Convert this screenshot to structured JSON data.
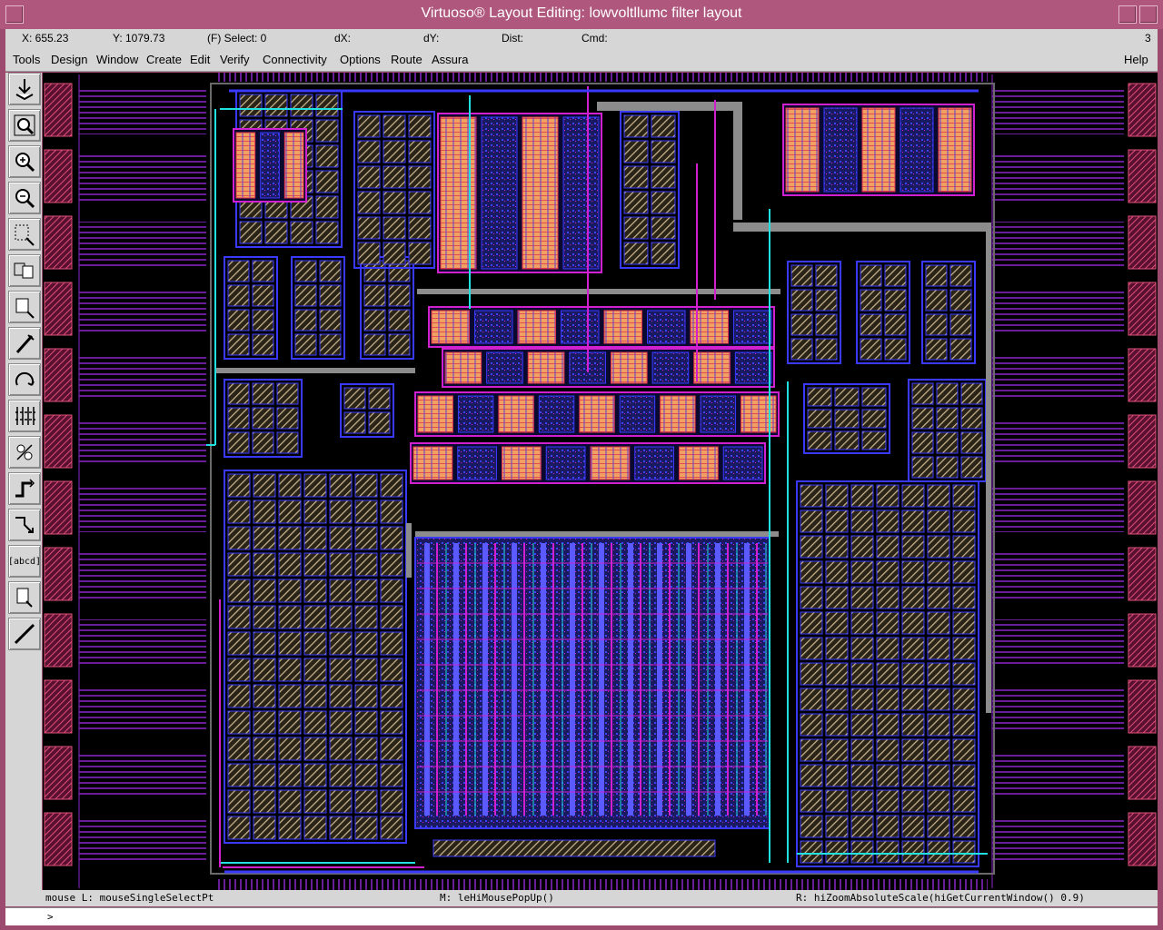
{
  "window": {
    "title": "Virtuoso® Layout Editing: lowvoltllumc filter layout"
  },
  "infobar": {
    "x": "X:  655.23",
    "y": "Y:  1079.73",
    "select": "(F) Select: 0",
    "dx": "dX:",
    "dy": "dY:",
    "dist": "Dist:",
    "cmd": "Cmd:",
    "count": "3"
  },
  "menu": {
    "items": [
      "Tools",
      "Design",
      "Window",
      "Create",
      "Edit",
      "Verify",
      "Connectivity",
      "Options",
      "Route",
      "Assura"
    ],
    "help": "Help"
  },
  "toolbar": {
    "icons": [
      "save-icon",
      "zoom-fit-icon",
      "zoom-in-icon",
      "zoom-out-icon",
      "stretch-icon",
      "copy-icon",
      "move-icon",
      "delete-icon",
      "undo-icon",
      "property-icon",
      "instance-icon",
      "path-icon",
      "polygon-icon",
      "label-icon",
      "rectangle-icon",
      "ruler-icon"
    ],
    "label_tool_text": "[abcd]"
  },
  "status": {
    "left": "mouse L: mouseSingleSelectPt",
    "middle": "M: leHiMousePopUp()",
    "right": "R: hiZoomAbsoluteScale(hiGetCurrentWindow() 0.9)"
  },
  "cmdline": {
    "prompt": ">"
  },
  "colors": {
    "title_bar": "#b0577e",
    "chrome": "#d6d6d6",
    "canvas_bg": "#000000",
    "metal_blue": "#3a3aff",
    "metal_magenta": "#d020d0",
    "cyan": "#20e0e0",
    "gray_route": "#8c8c8c",
    "pad_pink": "#e0507a",
    "block_beige": "#c8b48c"
  }
}
